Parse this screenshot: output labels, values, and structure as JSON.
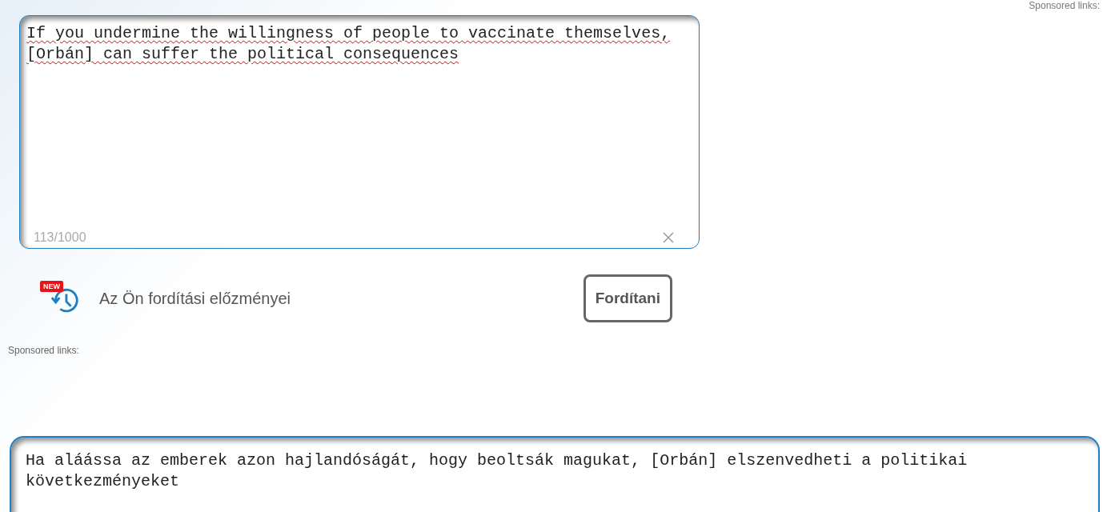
{
  "sponsored_top": "Sponsored links:",
  "source": {
    "value": "If you undermine the willingness of people to vaccinate themselves, [Orbán] can suffer the political consequences",
    "counter": "113/1000"
  },
  "history": {
    "badge": "NEW",
    "label": "Az Ön fordítási előzményei"
  },
  "translate_button": "Fordítani",
  "sponsored_middle": "Sponsored links:",
  "result": {
    "text": "Ha aláássa az emberek azon hajlandóságát, hogy beoltsák magukat, [Orbán] elszenvedheti a politikai következményeket"
  }
}
